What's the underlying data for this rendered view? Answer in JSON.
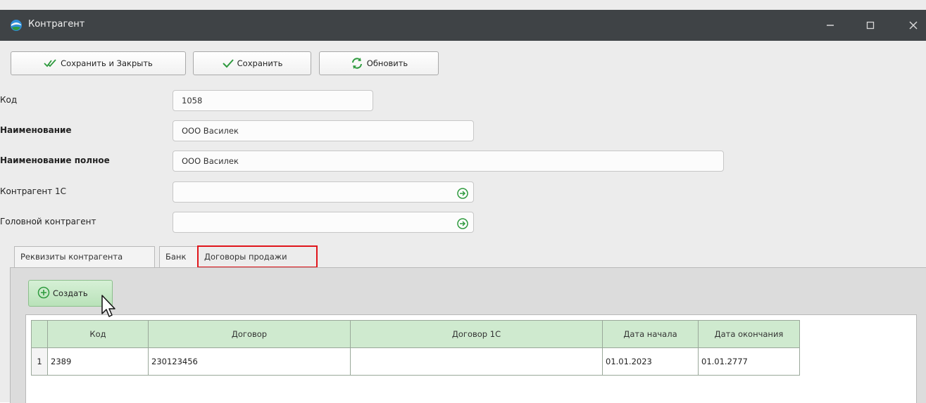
{
  "window": {
    "title": "Контрагент"
  },
  "toolbar": {
    "save_close_label": "Сохранить и Закрыть",
    "save_label": "Сохранить",
    "refresh_label": "Обновить"
  },
  "form": {
    "code": {
      "label": "Код",
      "value": "1058"
    },
    "name": {
      "label": "Наименование",
      "value": "ООО Василек"
    },
    "full_name": {
      "label": "Наименование полное",
      "value": "ООО Василек"
    },
    "counterparty_1c": {
      "label": "Контрагент 1С",
      "value": ""
    },
    "parent_counterparty": {
      "label": "Головной контрагент",
      "value": ""
    }
  },
  "tabs": [
    {
      "label": "Реквизиты контрагента"
    },
    {
      "label": "Банк"
    },
    {
      "label": "Договоры продажи"
    }
  ],
  "contracts": {
    "create_label": "Создать",
    "columns": [
      "Код",
      "Договор",
      "Договор 1С",
      "Дата начала",
      "Дата окончания"
    ],
    "rows": [
      {
        "num": "1",
        "code": "2389",
        "contract": "230123456",
        "contract_1c": "",
        "start": "01.01.2023",
        "end": "01.01.2777"
      }
    ]
  },
  "colors": {
    "titlebar": "#3f4346",
    "highlight": "#e0151b",
    "grid_header": "#cfeacf",
    "accent_green": "#2e9a3e"
  },
  "icons": {
    "app": "globe-icon",
    "save_close": "double-check-icon",
    "save": "check-icon",
    "refresh": "refresh-icon",
    "go": "arrow-circle-right-icon",
    "create": "plus-circle-icon"
  }
}
